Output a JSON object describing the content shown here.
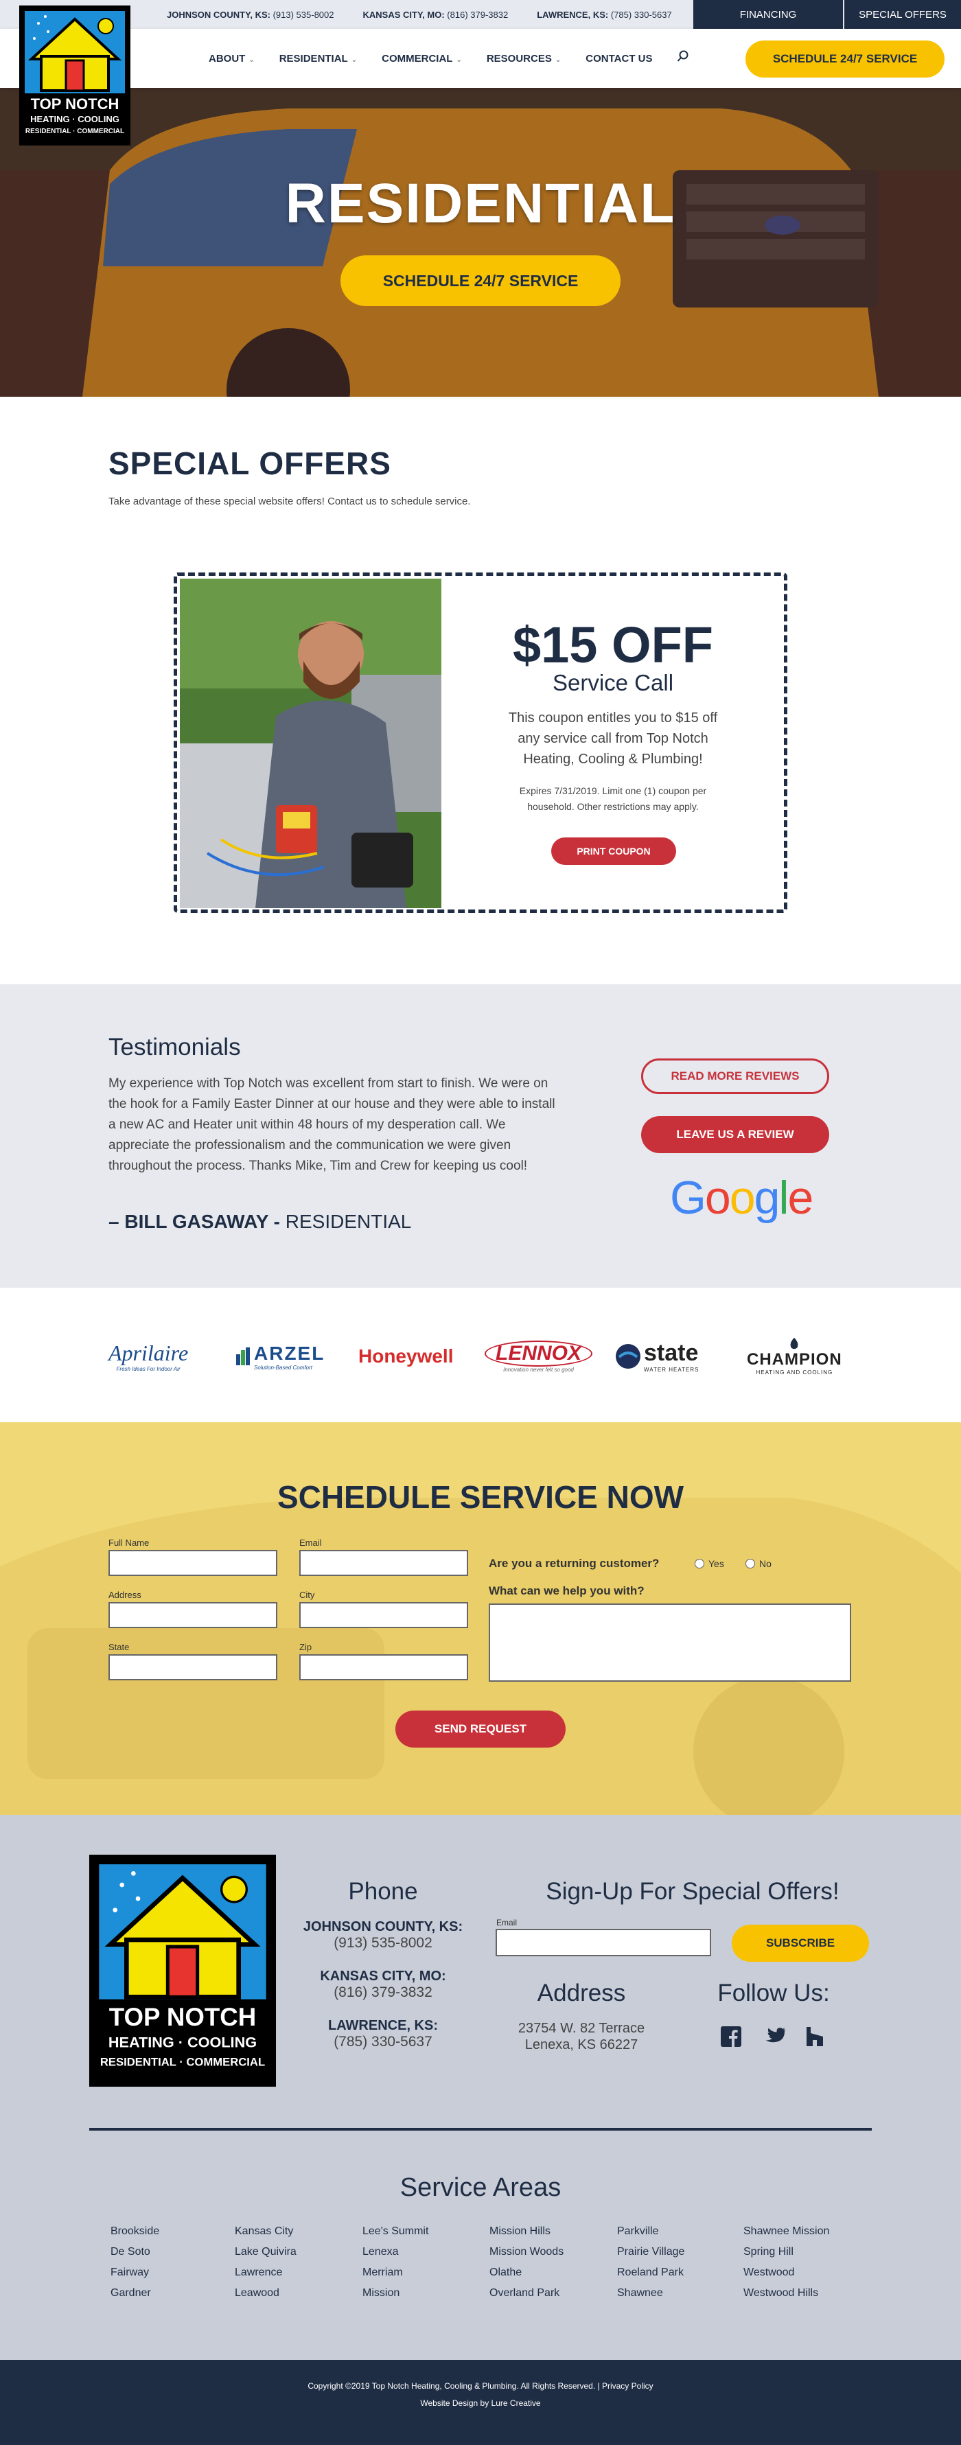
{
  "topbar": {
    "phones": [
      {
        "area": "JOHNSON COUNTY, KS:",
        "number": "(913) 535-8002"
      },
      {
        "area": "KANSAS CITY, MO:",
        "number": "(816) 379-3832"
      },
      {
        "area": "LAWRENCE, KS:",
        "number": "(785) 330-5637"
      }
    ],
    "financing": "FINANCING",
    "special_offers": "SPECIAL OFFERS"
  },
  "logo": {
    "line1": "TOP NOTCH",
    "line2": "HEATING · COOLING",
    "line3": "RESIDENTIAL · COMMERCIAL"
  },
  "nav": {
    "items": [
      "ABOUT",
      "RESIDENTIAL",
      "COMMERCIAL",
      "RESOURCES",
      "CONTACT US"
    ],
    "cta": "SCHEDULE 24/7 SERVICE"
  },
  "hero": {
    "title": "RESIDENTIAL",
    "cta": "SCHEDULE 24/7 SERVICE"
  },
  "offers": {
    "title": "SPECIAL OFFERS",
    "subtitle": "Take advantage of these special website offers! Contact us to schedule service.",
    "coupon": {
      "amount": "$15 OFF",
      "name": "Service Call",
      "description": "This coupon entitles you to $15 off any service call from Top Notch Heating, Cooling & Plumbing!",
      "fine_print": "Expires 7/31/2019.  Limit one (1) coupon per household. Other restrictions may apply.",
      "print_button": "PRINT COUPON"
    }
  },
  "testimonials": {
    "title": "Testimonials",
    "body": "My experience with Top Notch was excellent from start to finish. We were on the hook for a Family Easter Dinner at our house and they were able to install a new AC and Heater unit within 48 hours of my desperation call. We appreciate the professionalism and the communication we were given throughout the process. Thanks Mike, Tim and Crew for keeping us cool!",
    "author": "– BILL GASAWAY -",
    "category": "RESIDENTIAL",
    "read_more": "READ MORE REVIEWS",
    "leave_review": "LEAVE US A REVIEW",
    "google": [
      "G",
      "o",
      "o",
      "g",
      "l",
      "e"
    ]
  },
  "brands": {
    "aprilaire": {
      "name": "Aprilaire",
      "tag": "Fresh Ideas For Indoor Air"
    },
    "arzel": {
      "name": "ARZEL",
      "tag": "Solution-Based Comfort"
    },
    "honeywell": {
      "name": "Honeywell"
    },
    "lennox": {
      "name": "LENNOX",
      "tag": "Innovation never felt so good"
    },
    "state": {
      "name": "state",
      "tag": "WATER HEATERS"
    },
    "champion": {
      "name": "CHAMPION",
      "tag": "HEATING AND COOLING"
    }
  },
  "schedule": {
    "title": "SCHEDULE SERVICE NOW",
    "labels": {
      "full_name": "Full Name",
      "email": "Email",
      "address": "Address",
      "city": "City",
      "state": "State",
      "zip": "Zip"
    },
    "returning_q": "Are you a returning customer?",
    "yes": "Yes",
    "no": "No",
    "help_q": "What can we help you with?",
    "submit": "SEND REQUEST"
  },
  "footer": {
    "phone_title": "Phone",
    "phones": [
      {
        "area": "JOHNSON COUNTY, KS:",
        "number": "(913) 535-8002"
      },
      {
        "area": "KANSAS CITY, MO:",
        "number": "(816) 379-3832"
      },
      {
        "area": "LAWRENCE, KS:",
        "number": "(785) 330-5637"
      }
    ],
    "signup_title": "Sign-Up For Special Offers!",
    "signup_label": "Email",
    "subscribe": "SUBSCRIBE",
    "address_title": "Address",
    "address_line1": "23754 W. 82 Terrace",
    "address_line2": "Lenexa, KS 66227",
    "follow_title": "Follow Us:",
    "service_areas_title": "Service Areas",
    "service_areas": [
      [
        "Brookside",
        "De Soto",
        "Fairway",
        "Gardner"
      ],
      [
        "Kansas City",
        "Lake Quivira",
        "Lawrence",
        "Leawood"
      ],
      [
        "Lee's Summit",
        "Lenexa",
        "Merriam",
        "Mission"
      ],
      [
        "Mission Hills",
        "Mission Woods",
        "Olathe",
        "Overland Park"
      ],
      [
        "Parkville",
        "Prairie Village",
        "Roeland Park",
        "Shawnee"
      ],
      [
        "Shawnee Mission",
        "Spring Hill",
        "Westwood",
        "Westwood Hills"
      ]
    ],
    "copyright": "Copyright ©2019 Top Notch Heating, Cooling & Plumbing. All Rights Reserved. | Privacy Policy",
    "credit": "Website Design by Lure Creative"
  },
  "colors": {
    "navy": "#1f2d44",
    "yellow": "#f8c200",
    "red": "#c8313a",
    "light": "#e7e9ee",
    "footer": "#c8cdd7"
  }
}
